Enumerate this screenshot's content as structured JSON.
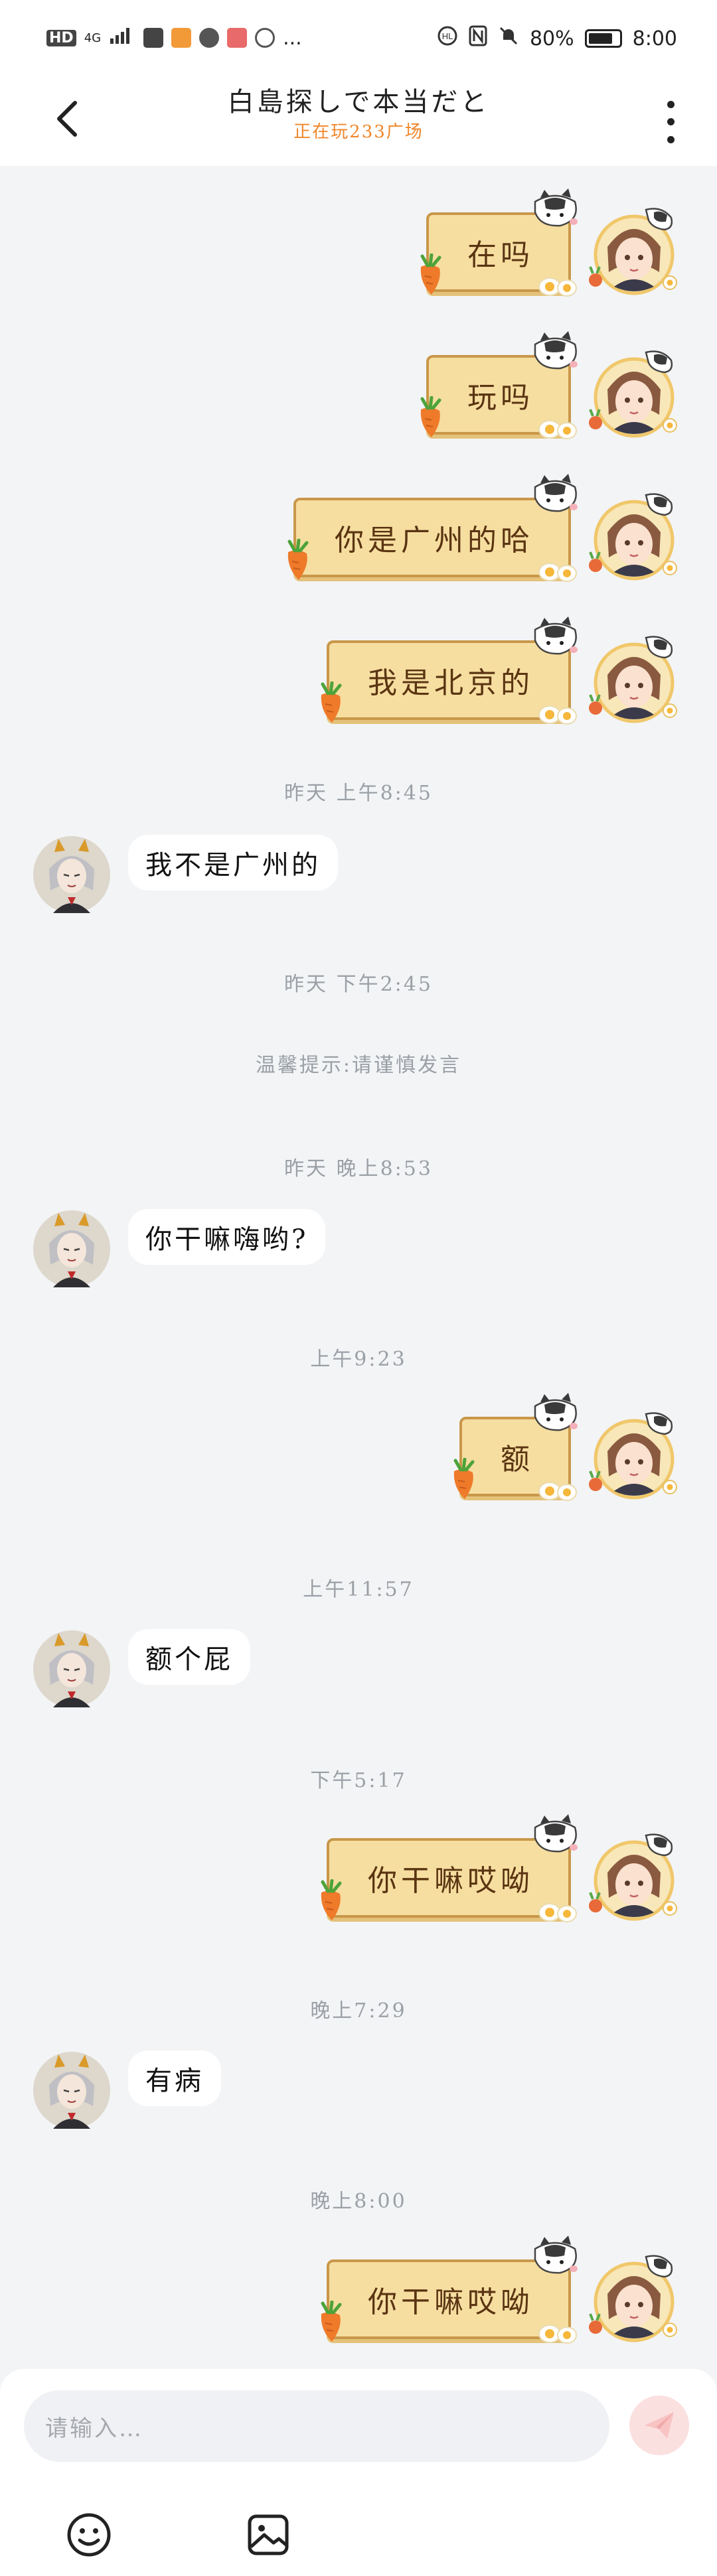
{
  "status_bar": {
    "left_icons": [
      "HD",
      "4G",
      "signal-icon",
      "upload-icon",
      "video-app-icon",
      "qq-icon",
      "mail-app-icon",
      "circle-icon",
      "..."
    ],
    "battery": "80%",
    "battery_level": 0.8,
    "time": "8:00"
  },
  "header": {
    "title": "白島探しで本当だと",
    "subtitle": "正在玩233广场"
  },
  "messages": [
    {
      "side": "right",
      "text": "在吗"
    },
    {
      "side": "right",
      "text": "玩吗"
    },
    {
      "side": "right",
      "text": "你是广州的哈"
    },
    {
      "side": "right",
      "text": "我是北京的"
    },
    {
      "timestamp": "昨天 上午8:45"
    },
    {
      "side": "left",
      "text": "我不是广州的"
    },
    {
      "timestamp": "昨天 下午2:45"
    },
    {
      "notice": "温馨提示:请谨慎发言"
    },
    {
      "timestamp": "昨天 晚上8:53"
    },
    {
      "side": "left",
      "text": "你干嘛嗨哟?"
    },
    {
      "timestamp": "上午9:23"
    },
    {
      "side": "right",
      "text": "额"
    },
    {
      "timestamp": "上午11:57"
    },
    {
      "side": "left",
      "text": "额个屁"
    },
    {
      "timestamp": "下午5:17"
    },
    {
      "side": "right",
      "text": "你干嘛哎呦"
    },
    {
      "timestamp": "晚上7:29"
    },
    {
      "side": "left",
      "text": "有病"
    },
    {
      "timestamp": "晚上8:00"
    },
    {
      "side": "right",
      "text": "你干嘛哎呦"
    }
  ],
  "input": {
    "placeholder": "请输入…"
  },
  "colors": {
    "accent_subtitle": "#f0862a",
    "sticker_bg": "#f6dea0",
    "sticker_border": "#c9974a",
    "send_button_bg": "#fbe0e0",
    "page_bg": "#f3f4f6"
  },
  "icons": {
    "back": "chevron-left-icon",
    "more": "more-vertical-icon",
    "send": "paper-plane-icon",
    "emoji": "smiley-icon",
    "image": "image-icon"
  }
}
